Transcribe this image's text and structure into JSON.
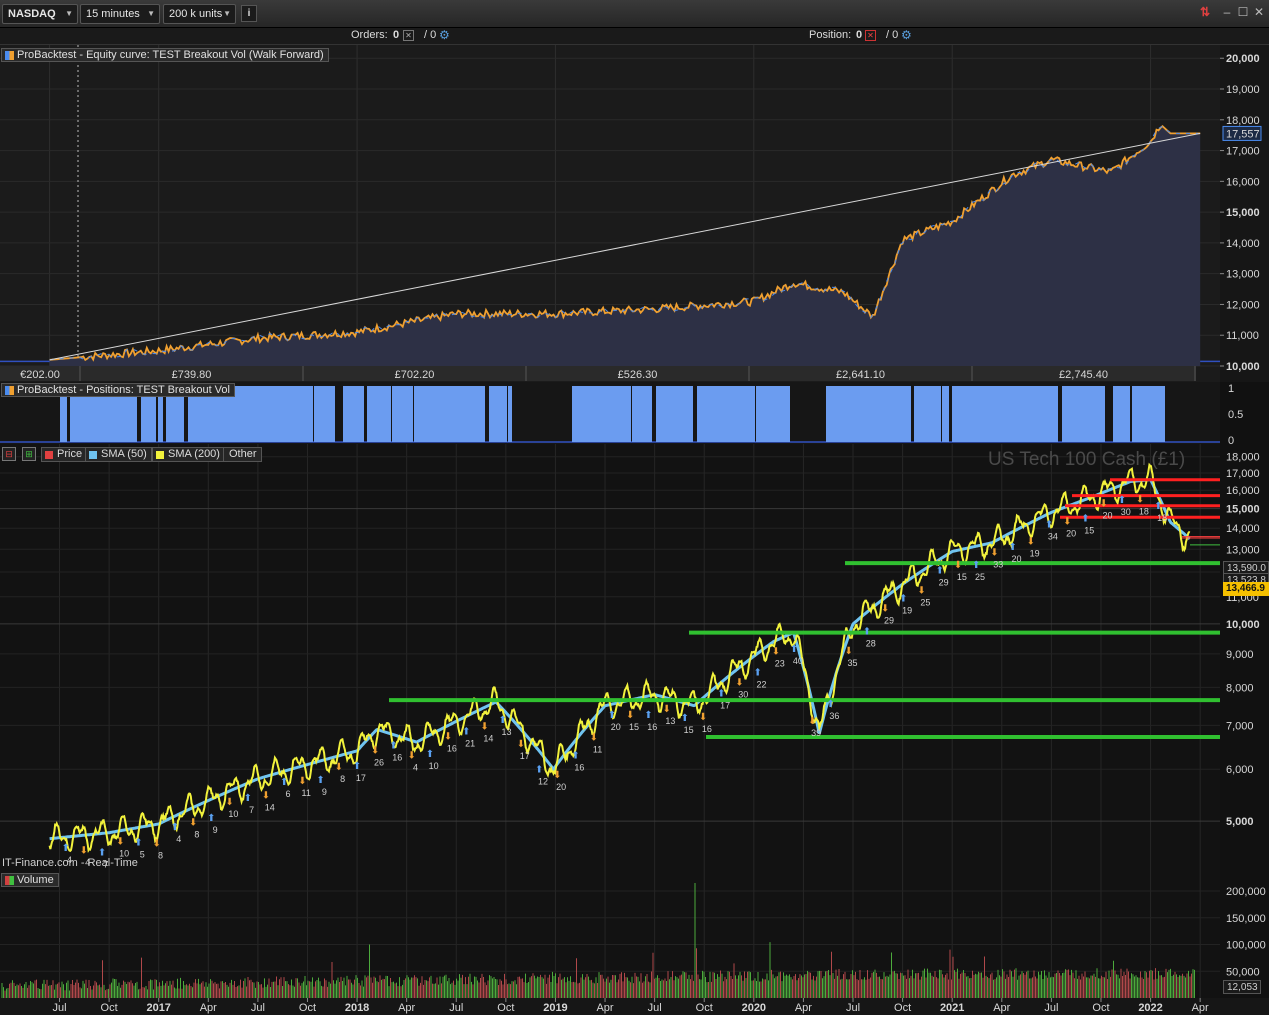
{
  "toolbar": {
    "market": "NASDAQ",
    "timeframe": "15 minutes",
    "units": "200 k units",
    "info_icon": "info-icon"
  },
  "orders_bar": {
    "orders_label": "Orders:",
    "orders_value": "0",
    "orders_sep": "/ 0",
    "position_label": "Position:",
    "position_value": "0",
    "position_sep": "/ 0"
  },
  "equity_panel": {
    "title": "ProBacktest - Equity curve: TEST Breakout Vol (Walk Forward)",
    "y_ticks": [
      "20,000",
      "19,000",
      "18,000",
      "17,000",
      "16,000",
      "15,000",
      "14,000",
      "13,000",
      "12,000",
      "11,000",
      "10,000"
    ],
    "current_value": "17,557",
    "gain_labels": [
      "€202.00",
      "£739.80",
      "£702.20",
      "£526.30",
      "£2,641.10",
      "£2,745.40"
    ]
  },
  "positions_panel": {
    "title": "ProBacktest - Positions: TEST Breakout Vol",
    "y_ticks": [
      "1",
      "0.5",
      "0"
    ]
  },
  "price_panel": {
    "legend": {
      "price": "Price",
      "sma50": "SMA (50)",
      "sma200": "SMA (200)",
      "other": "Other"
    },
    "instrument": "US Tech 100 Cash (£1)",
    "source": "IT-Finance.com - Real-Time",
    "y_ticks": [
      "18,000",
      "17,000",
      "16,000",
      "15,000",
      "14,000",
      "13,000",
      "12,000",
      "11,000",
      "10,000",
      "9,000",
      "8,000",
      "7,000",
      "6,000",
      "5,000"
    ],
    "price_tags": [
      "13,590.0",
      "13,523.8",
      "13,466.9"
    ],
    "trade_counts": [
      "4",
      "4",
      "7",
      "10",
      "5",
      "8",
      "4",
      "8",
      "9",
      "10",
      "7",
      "14",
      "6",
      "11",
      "9",
      "8",
      "17",
      "26",
      "16",
      "4",
      "10",
      "16",
      "21",
      "14",
      "13",
      "17",
      "12",
      "20",
      "16",
      "11",
      "20",
      "15",
      "16",
      "13",
      "15",
      "16",
      "17",
      "30",
      "22",
      "23",
      "40",
      "39",
      "36",
      "35",
      "28",
      "29",
      "19",
      "25",
      "29",
      "15",
      "25",
      "33",
      "20",
      "19",
      "34",
      "20",
      "15",
      "20",
      "30",
      "18",
      "18"
    ]
  },
  "volume_panel": {
    "title": "Volume",
    "y_ticks": [
      "200,000",
      "150,000",
      "100,000",
      "50,000"
    ],
    "current_value": "12,053"
  },
  "x_axis": {
    "labels": [
      "Jul",
      "Oct",
      "2017",
      "Apr",
      "Jul",
      "Oct",
      "2018",
      "Apr",
      "Jul",
      "Oct",
      "2019",
      "Apr",
      "Jul",
      "Oct",
      "2020",
      "Apr",
      "Jul",
      "Oct",
      "2021",
      "Apr",
      "Jul",
      "Oct",
      "2022",
      "Apr"
    ],
    "bold": [
      false,
      false,
      true,
      false,
      false,
      false,
      true,
      false,
      false,
      false,
      true,
      false,
      false,
      false,
      true,
      false,
      false,
      false,
      true,
      false,
      false,
      false,
      true,
      false
    ]
  },
  "colors": {
    "equity_up": "#4a8cf0",
    "equity_down": "#f0a030",
    "position_fill": "#6b9cf0",
    "price_line": "#f2f23c",
    "sma50": "#6fc3f0",
    "resistance": "#ff2020",
    "support": "#30c030",
    "current_price": "#f5c000"
  },
  "chart_data": [
    {
      "type": "line",
      "title": "ProBacktest - Equity curve: TEST Breakout Vol (Walk Forward)",
      "ylim": [
        10000,
        20300
      ],
      "x": [
        2016.45,
        2017.0,
        2017.5,
        2018.0,
        2018.5,
        2019.0,
        2019.5,
        2020.0,
        2020.2,
        2020.45,
        2020.6,
        2020.75,
        2021.0,
        2021.3,
        2021.5,
        2021.8,
        2022.0,
        2022.05,
        2022.1,
        2022.25
      ],
      "values": [
        10200,
        10500,
        10900,
        11100,
        11700,
        11700,
        11850,
        12100,
        12700,
        12400,
        11600,
        14100,
        14700,
        16200,
        16700,
        16300,
        17300,
        17850,
        17557,
        17557
      ]
    },
    {
      "type": "line",
      "title": "US Tech 100 Cash (£1)",
      "ylim": [
        4300,
        18300
      ],
      "series": [
        {
          "name": "Price",
          "x": [
            2016.45,
            2016.75,
            2017.0,
            2017.5,
            2018.0,
            2018.1,
            2018.3,
            2018.7,
            2018.99,
            2019.25,
            2019.5,
            2019.7,
            2020.1,
            2020.2,
            2020.33,
            2020.5,
            2020.75,
            2021.0,
            2021.2,
            2021.5,
            2021.7,
            2021.9,
            2022.0,
            2022.1,
            2022.2
          ],
          "values": [
            4700,
            4800,
            4950,
            5800,
            6400,
            6900,
            6600,
            7600,
            6000,
            7500,
            7800,
            7500,
            9400,
            9700,
            6800,
            10000,
            11500,
            12900,
            13300,
            14800,
            15600,
            16500,
            16600,
            14300,
            13466.9
          ]
        }
      ]
    },
    {
      "type": "bar",
      "title": "Volume",
      "ylim": [
        0,
        230000
      ],
      "values": [
        12053
      ]
    }
  ]
}
